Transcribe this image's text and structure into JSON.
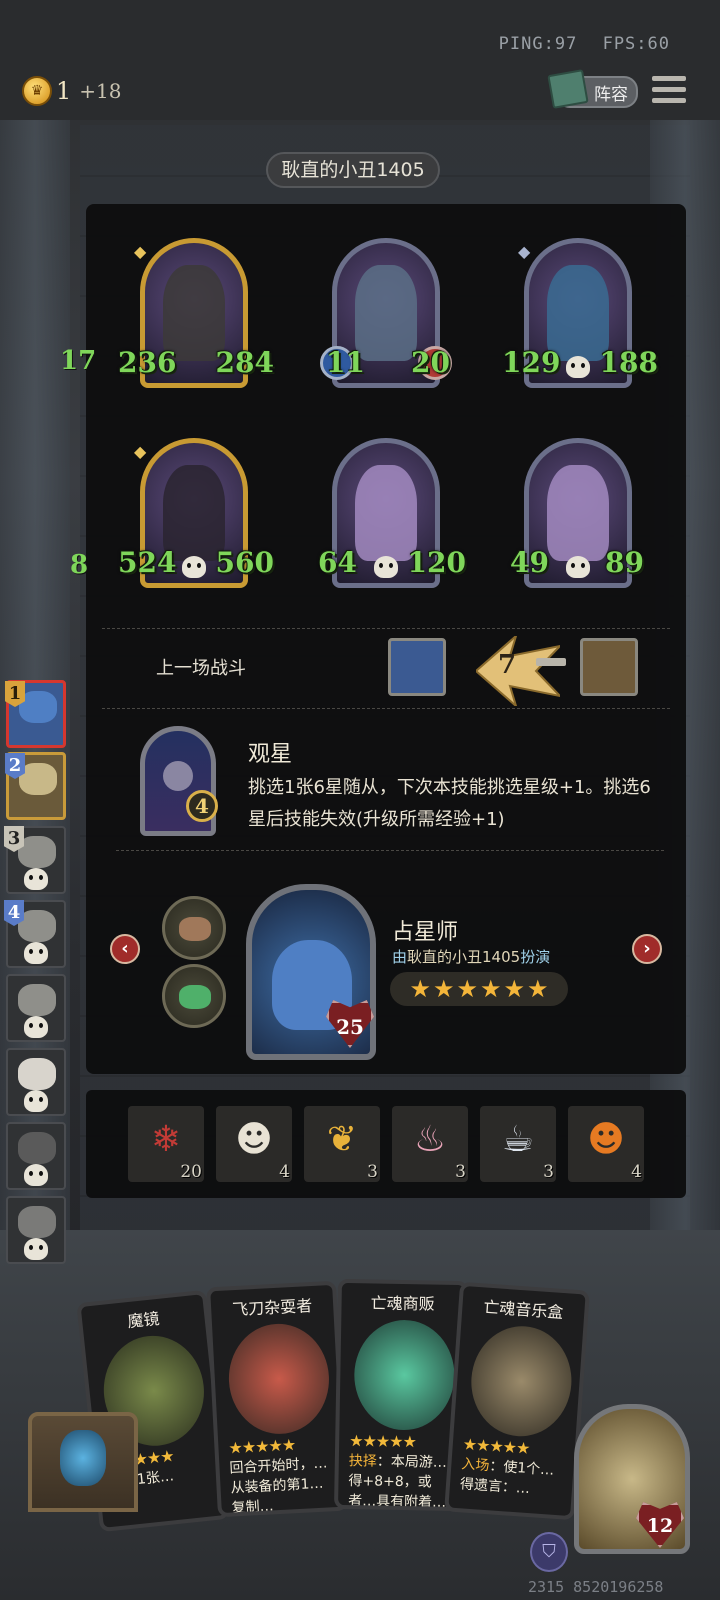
{
  "status": {
    "ping": "PING:97",
    "fps": "FPS:60"
  },
  "coins": {
    "value": "1",
    "income": "+18"
  },
  "lineup_button": "阵容",
  "opponent": {
    "name": "耿直的小丑1405"
  },
  "board": {
    "row1": [
      {
        "atk": "236",
        "hp": "284",
        "frame": "gold"
      },
      {
        "atk": "11",
        "hp": "20",
        "frame": "silver"
      },
      {
        "atk": "129",
        "hp": "188",
        "frame": "silver"
      }
    ],
    "row2": [
      {
        "atk": "524",
        "hp": "560",
        "frame": "gold"
      },
      {
        "atk": "64",
        "hp": "120",
        "frame": "silver"
      },
      {
        "atk": "49",
        "hp": "89",
        "frame": "silver"
      }
    ],
    "side_left_1": "17",
    "side_left_2": "8"
  },
  "last_battle": {
    "label": "上一场战斗",
    "damage": "7"
  },
  "skill": {
    "name": "观星",
    "level": "4",
    "description": "挑选1张6星随从，下次本技能挑选星级+1。挑选6星后技能失效(升级所需经验+1)"
  },
  "hero": {
    "name": "占星师",
    "played_by_prefix": "由",
    "played_by_name": "耿直的小丑1405",
    "played_by_suffix": "扮演",
    "stars": 6,
    "hp": "25"
  },
  "items": [
    {
      "icon": "snowflake-icon",
      "count": "20",
      "color": "#c23b36",
      "glyph": "❄"
    },
    {
      "icon": "clown-icon",
      "count": "4",
      "color": "#e8e2d4",
      "glyph": "☻"
    },
    {
      "icon": "bird-icon",
      "count": "3",
      "color": "#e8b23a",
      "glyph": "❦"
    },
    {
      "icon": "cupcake-icon",
      "count": "3",
      "color": "#e9a4b8",
      "glyph": "♨"
    },
    {
      "icon": "teacup-icon",
      "count": "3",
      "color": "#dfe6ef",
      "glyph": "☕"
    },
    {
      "icon": "pumpkin-icon",
      "count": "4",
      "color": "#e67a22",
      "glyph": "☻"
    }
  ],
  "players": [
    {
      "rank": "1",
      "state": "active"
    },
    {
      "rank": "2",
      "state": "second"
    },
    {
      "rank": "3",
      "state": "dead"
    },
    {
      "rank": "4",
      "state": "dead"
    },
    {
      "rank": "",
      "state": "dead"
    },
    {
      "rank": "",
      "state": "dead"
    },
    {
      "rank": "",
      "state": "dead"
    },
    {
      "rank": "",
      "state": "dead"
    }
  ],
  "hand": [
    {
      "title": "魔镜",
      "text": "…替1张…"
    },
    {
      "title": "飞刀杂耍者",
      "text": "回合开始时，…从装备的第1…复制…"
    },
    {
      "title": "亡魂商贩",
      "text_prefix": "抉择",
      "text": "：本局游…得+8+8，或者…具有附着…"
    },
    {
      "title": "亡魂音乐盒",
      "text_prefix": "入场",
      "text": "：使1个…得遗言：…"
    }
  ],
  "relic": {
    "hp": "12"
  },
  "footer_id": "2315 8520196258"
}
